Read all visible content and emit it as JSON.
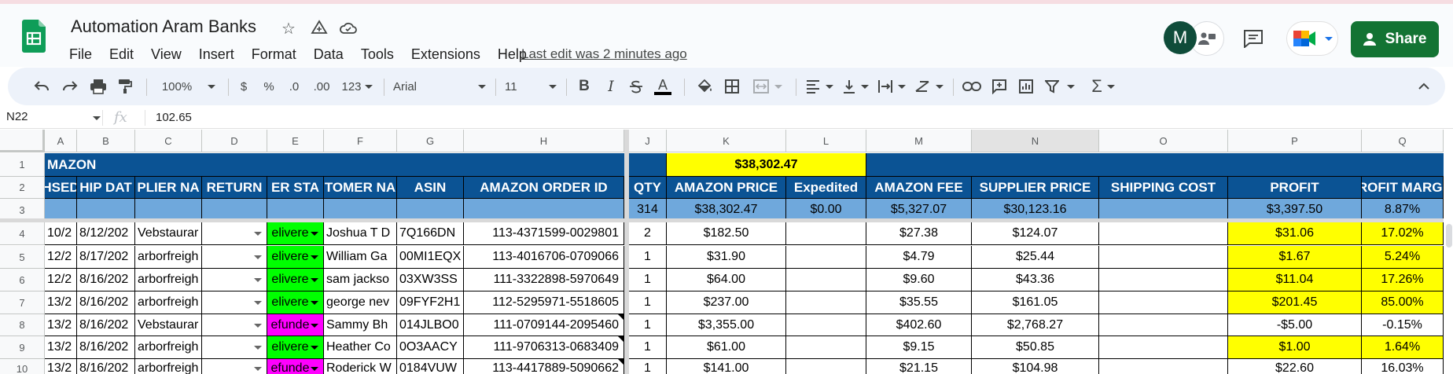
{
  "app": {
    "title": "Automation Aram Banks",
    "last_edit": "Last edit was 2 minutes ago",
    "menu": [
      "File",
      "Edit",
      "View",
      "Insert",
      "Format",
      "Data",
      "Tools",
      "Extensions",
      "Help"
    ],
    "avatar_initial": "M",
    "share_label": "Share"
  },
  "toolbar": {
    "zoom": "100%",
    "currency": "$",
    "percent": "%",
    "decrease_decimal": ".0",
    "increase_decimal": ".00",
    "number_format": "123",
    "font": "Arial",
    "font_size": "11",
    "bold": "B",
    "italic": "I",
    "text_color_letter": "A"
  },
  "formula_bar": {
    "cell_ref": "N22",
    "fx": "fx",
    "value": "102.65"
  },
  "columns": [
    "A",
    "B",
    "C",
    "D",
    "E",
    "F",
    "G",
    "H",
    "J",
    "K",
    "L",
    "M",
    "N",
    "O",
    "P",
    "Q"
  ],
  "rows": [
    "1",
    "2",
    "3",
    "4",
    "5",
    "6",
    "7",
    "8",
    "9",
    "10"
  ],
  "sheet": {
    "row1": {
      "a": "MAZON",
      "k": "$38,302.47"
    },
    "row2": [
      "HSED",
      "HIP DAT",
      "PLIER NA",
      "RETURN",
      "ER STA",
      "TOMER NA",
      "ASIN",
      "AMAZON ORDER ID",
      "QTY",
      "AMAZON PRICE",
      "Expedited",
      "AMAZON FEE",
      "SUPPLIER PRICE",
      "SHIPPING COST",
      "PROFIT",
      "PROFIT MARGIN"
    ],
    "row3": {
      "j": "314",
      "k": "$38,302.47",
      "l": "$0.00",
      "m": "$5,327.07",
      "n": "$30,123.16",
      "p": "$3,397.50",
      "q": "8.87%"
    },
    "data": [
      [
        "10/2",
        "8/12/202",
        "Vebstaurar",
        "",
        "elivere",
        "Joshua T D",
        "7Q166DN",
        "113-4371599-0029801",
        "2",
        "$182.50",
        "",
        "$27.38",
        "$124.07",
        "",
        "$31.06",
        "17.02%"
      ],
      [
        "12/2",
        "8/17/202",
        "arborfreigh",
        "",
        "elivere",
        "William Ga",
        "00MI1EQX",
        "113-4016706-0709066",
        "1",
        "$31.90",
        "",
        "$4.79",
        "$25.44",
        "",
        "$1.67",
        "5.24%"
      ],
      [
        "12/2",
        "8/16/202",
        "arborfreigh",
        "",
        "elivere",
        "sam jackso",
        "03XW3SS",
        "111-3322898-5970649",
        "1",
        "$64.00",
        "",
        "$9.60",
        "$43.36",
        "",
        "$11.04",
        "17.26%"
      ],
      [
        "13/2",
        "8/16/202",
        "arborfreigh",
        "",
        "elivere",
        "george nev",
        "09FYF2H1",
        "112-5295971-5518605",
        "1",
        "$237.00",
        "",
        "$35.55",
        "$161.05",
        "",
        "$201.45",
        "85.00%"
      ],
      [
        "13/2",
        "8/16/202",
        "Vebstaurar",
        "",
        "efunde",
        "Sammy Bh",
        "014JLBO0",
        "111-0709144-2095460",
        "1",
        "$3,355.00",
        "",
        "$402.60",
        "$2,768.27",
        "",
        "-$5.00",
        "-0.15%"
      ],
      [
        "13/2",
        "8/16/202",
        "arborfreigh",
        "",
        "elivere",
        "Heather Co",
        "0O3AACY",
        "111-9706313-0683409",
        "1",
        "$61.00",
        "",
        "$9.15",
        "$50.85",
        "",
        "$1.00",
        "1.64%"
      ],
      [
        "13/2",
        "8/16/202",
        "arborfreigh",
        "",
        "efunde",
        "Roderick W",
        "0184VUW",
        "113-4417889-5090662",
        "1",
        "$141.00",
        "",
        "$21.15",
        "$104.98",
        "",
        "$22.60",
        "16.03%"
      ]
    ],
    "status_colors": [
      "green",
      "green",
      "green",
      "green",
      "magenta",
      "green",
      "magenta"
    ],
    "highlight_rows": [
      true,
      true,
      true,
      true,
      false,
      true,
      false
    ]
  },
  "colors": {
    "header_blue": "#0b5394",
    "summary_blue": "#6fa8dc",
    "highlight_yellow": "#ffff00",
    "delivered_green": "#00ff00",
    "refunded_magenta": "#ff00ff",
    "share_green": "#137333"
  },
  "icons": [
    "sheets-logo",
    "star-icon",
    "move-to-drive-icon",
    "cloud-saved-icon",
    "comment-icon",
    "meet-icon",
    "person-add-icon",
    "undo-icon",
    "redo-icon",
    "print-icon",
    "paint-format-icon",
    "strikethrough-icon",
    "fill-color-icon",
    "borders-icon",
    "merge-icon",
    "align-icon",
    "valign-icon",
    "wrap-icon",
    "rotate-icon",
    "link-icon",
    "insert-comment-icon",
    "insert-chart-icon",
    "filter-icon",
    "functions-icon",
    "collapse-icon"
  ]
}
